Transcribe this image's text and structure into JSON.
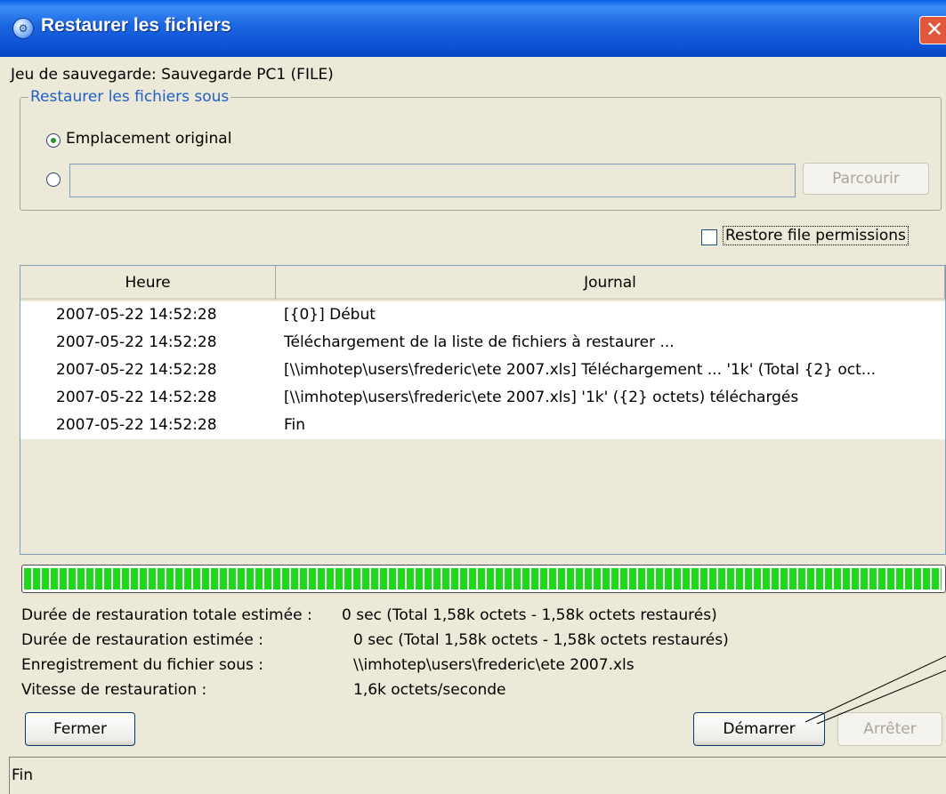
{
  "window": {
    "title": "Restaurer les fichiers",
    "close_symbol": "✕"
  },
  "backup_set": "Jeu de sauvegarde: Sauvegarde PC1 (FILE)",
  "restore_group": {
    "legend": "Restaurer les fichiers sous",
    "option_original": "Emplacement original",
    "option_original_selected": true,
    "custom_path_value": "",
    "browse_label": "Parcourir"
  },
  "restore_permissions": {
    "label": "Restore file permissions",
    "checked": false
  },
  "log_table": {
    "columns": [
      "Heure",
      "Journal"
    ],
    "rows": [
      {
        "time": "2007-05-22 14:52:28",
        "log": "[{0}] Début"
      },
      {
        "time": "2007-05-22 14:52:28",
        "log": "Téléchargement de la liste de fichiers à restaurer ..."
      },
      {
        "time": "2007-05-22 14:52:28",
        "log": "[\\\\imhotep\\users\\frederic\\ete 2007.xls] Téléchargement ... '1k' (Total {2} oct..."
      },
      {
        "time": "2007-05-22 14:52:28",
        "log": "[\\\\imhotep\\users\\frederic\\ete 2007.xls] '1k' ({2} octets) téléchargés"
      },
      {
        "time": "2007-05-22 14:52:28",
        "log": "Fin"
      }
    ]
  },
  "progress": {
    "fraction": 1.0,
    "color": "#1ed81a"
  },
  "stats": [
    {
      "label": "Durée de restauration totale estimée :",
      "value": "0 sec (Total 1,58k octets - 1,58k octets restaurés)"
    },
    {
      "label": "Durée de restauration estimée :",
      "value": "0 sec (Total 1,58k octets - 1,58k octets restaurés)"
    },
    {
      "label": "Enregistrement du fichier sous :",
      "value": "\\\\imhotep\\users\\frederic\\ete 2007.xls"
    },
    {
      "label": "Vitesse de restauration :",
      "value": "1,6k octets/seconde"
    }
  ],
  "buttons": {
    "close": "Fermer",
    "start": "Démarrer",
    "stop": "Arrêter"
  },
  "status_bar": "Fin",
  "icons": {
    "app": "app-gear-icon",
    "close": "close-icon"
  }
}
